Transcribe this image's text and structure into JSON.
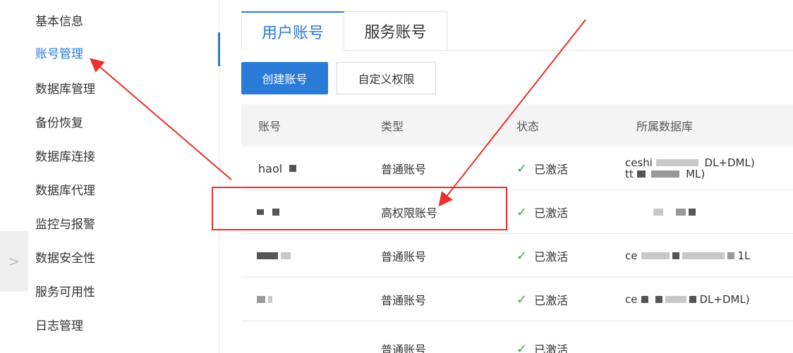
{
  "sidebar": {
    "items": [
      {
        "label": "基本信息"
      },
      {
        "label": "账号管理"
      },
      {
        "label": "数据库管理"
      },
      {
        "label": "备份恢复"
      },
      {
        "label": "数据库连接"
      },
      {
        "label": "数据库代理"
      },
      {
        "label": "监控与报警"
      },
      {
        "label": "数据安全性"
      },
      {
        "label": "服务可用性"
      },
      {
        "label": "日志管理"
      }
    ],
    "active_index": 1,
    "collapse_glyph": ">"
  },
  "tabs": [
    {
      "label": "用户账号",
      "active": true
    },
    {
      "label": "服务账号",
      "active": false
    }
  ],
  "toolbar": {
    "create_label": "创建账号",
    "custom_label": "自定义权限"
  },
  "table": {
    "headers": [
      "账号",
      "类型",
      "状态",
      "所属数据库"
    ],
    "rows": [
      {
        "account": "haol",
        "type": "普通账号",
        "status": "已激活",
        "db_line1": "ceshi",
        "db_line1_tail": "DL+DML)",
        "db_line2": "tt",
        "db_line2_tail": "ML)"
      },
      {
        "account": "",
        "type": "高权限账号",
        "status": "已激活",
        "db_line1": "",
        "db_line1_tail": "",
        "db_line2": "",
        "db_line2_tail": ""
      },
      {
        "account": "",
        "type": "普通账号",
        "status": "已激活",
        "db_line1": "ce",
        "db_line1_tail": "1L",
        "db_line2": "",
        "db_line2_tail": ""
      },
      {
        "account": "",
        "type": "普通账号",
        "status": "已激活",
        "db_line1": "ce",
        "db_line1_tail": "DL+DML)",
        "db_line2": "",
        "db_line2_tail": ""
      },
      {
        "account": "",
        "type": "普通账号",
        "status": "已激活",
        "db_line1": "",
        "db_line1_tail": "",
        "db_line2": "",
        "db_line2_tail": ""
      }
    ]
  },
  "colors": {
    "accent": "#2a7bd8",
    "annotation": "#e8312c",
    "success": "#3aa64a"
  },
  "icons": {
    "check": "check-icon",
    "collapse": "chevron-right-icon"
  }
}
